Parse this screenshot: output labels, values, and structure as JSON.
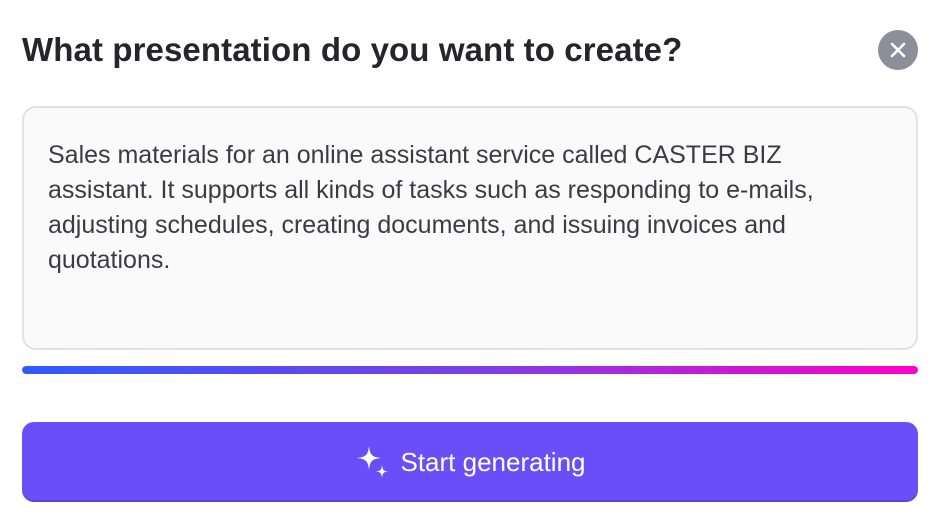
{
  "dialog": {
    "title": "What presentation do you want to create?",
    "close_icon": "close-icon"
  },
  "prompt": {
    "value": "Sales materials for an online assistant service called CASTER BIZ assistant. It supports all kinds of tasks such as responding to e-mails, adjusting schedules, creating documents, and issuing invoices and quotations."
  },
  "progress": {
    "percent": 100,
    "colors": [
      "#2d5bff",
      "#7b3fe4",
      "#ff00c8"
    ]
  },
  "generate_button": {
    "label": "Start generating",
    "icon": "sparkle-icon",
    "color": "#6a4ff8"
  }
}
